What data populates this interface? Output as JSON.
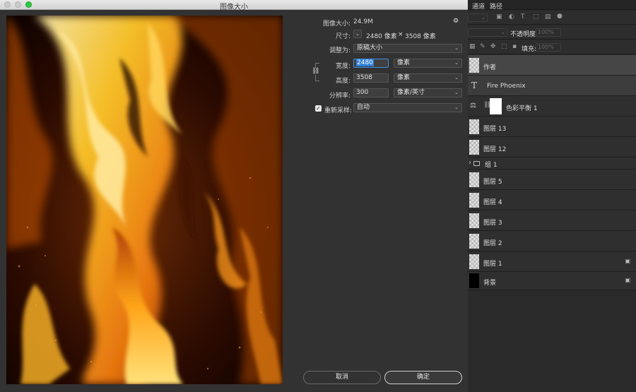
{
  "window": {
    "title": "图像大小"
  },
  "dialog": {
    "image_size_label": "图像大小:",
    "image_size_value": "24.9M",
    "dimensions_label": "尺寸:",
    "dimensions_width": "2480 像素",
    "dimensions_x": "×",
    "dimensions_height": "3508 像素",
    "fit_to_label": "调整为:",
    "fit_to_value": "原稿大小",
    "width_label": "宽度:",
    "width_value": "2480",
    "width_unit": "像素",
    "height_label": "高度:",
    "height_value": "3508",
    "height_unit": "像素",
    "resolution_label": "分辨率:",
    "resolution_value": "300",
    "resolution_unit": "像素/英寸",
    "resample_label": "重新采样:",
    "resample_value": "自动",
    "resample_checked": true,
    "cancel_label": "取消",
    "ok_label": "确定"
  },
  "panel": {
    "tabs": [
      "通道",
      "路径"
    ],
    "opacity_label": "不透明度:",
    "opacity_value": "100%",
    "fill_label": "填充:",
    "fill_value": "100%",
    "layers": [
      {
        "name": "作者",
        "type": "pixel",
        "selected": true,
        "locked": false
      },
      {
        "name": "Fire Phoenix",
        "type": "text",
        "selected": false,
        "locked": false
      },
      {
        "name": "色彩平衡 1",
        "type": "adjustment",
        "selected": false,
        "locked": false
      },
      {
        "name": "图层 13",
        "type": "pixel",
        "selected": false,
        "locked": false
      },
      {
        "name": "图层 12",
        "type": "pixel",
        "selected": false,
        "locked": false
      },
      {
        "name": "组 1",
        "type": "group",
        "selected": false,
        "locked": false
      },
      {
        "name": "图层 5",
        "type": "pixel",
        "selected": false,
        "locked": false
      },
      {
        "name": "图层 4",
        "type": "pixel",
        "selected": false,
        "locked": false
      },
      {
        "name": "图层 3",
        "type": "pixel",
        "selected": false,
        "locked": false
      },
      {
        "name": "图层 2",
        "type": "pixel",
        "selected": false,
        "locked": false
      },
      {
        "name": "图层 1",
        "type": "pixel",
        "selected": false,
        "locked": true
      },
      {
        "name": "背景",
        "type": "background",
        "selected": false,
        "locked": true
      }
    ]
  },
  "icons": {
    "gear": "⚙",
    "chevron": "⌄",
    "link": "⛓",
    "lock": "🔒",
    "text_layer": "T",
    "folder": "▭",
    "folder_chevron": "›",
    "balance": "⚖",
    "check": "✓"
  },
  "colors": {
    "accent": "#2f7fd8",
    "fire_bright": "#ffd23a",
    "fire_orange": "#f07a10",
    "fire_dark": "#120400"
  }
}
